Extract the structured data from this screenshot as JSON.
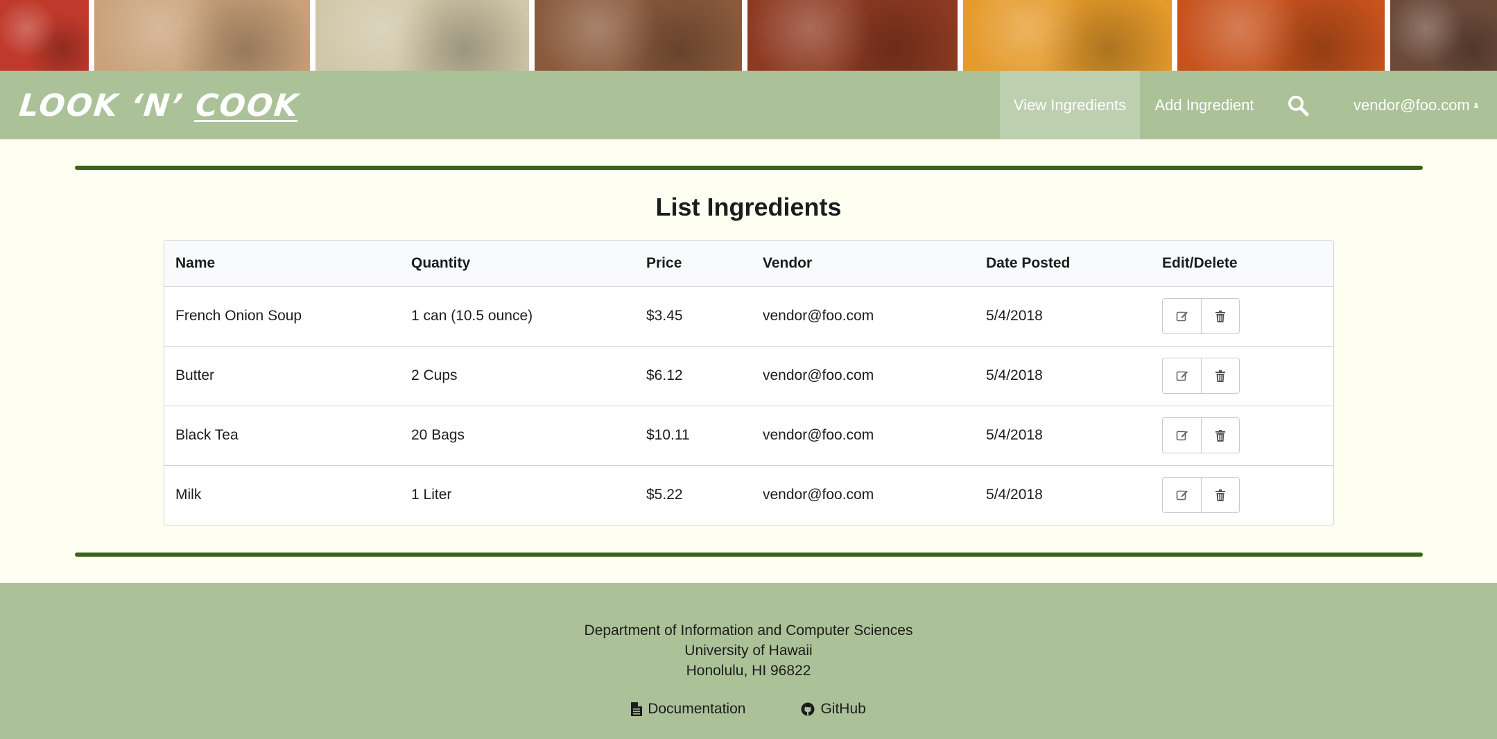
{
  "banner": {
    "tiles": [
      {
        "name": "strawberry-photo",
        "color": "#c0392b"
      },
      {
        "name": "bread-photo",
        "color": "#c9a27a"
      },
      {
        "name": "salad-photo",
        "color": "#cfc7a8"
      },
      {
        "name": "granola-photo",
        "color": "#8a5a3c"
      },
      {
        "name": "tomato-photo",
        "color": "#8e3a22"
      },
      {
        "name": "mango-photo",
        "color": "#e59a2a"
      },
      {
        "name": "glazed-chicken-photo",
        "color": "#c7521c"
      },
      {
        "name": "chocolate-photo",
        "color": "#6b4a3a"
      }
    ]
  },
  "nav": {
    "logo_part1": "LOOK ‘N’",
    "logo_part2": "COOK",
    "view_ingredients": "View Ingredients",
    "add_ingredient": "Add Ingredient",
    "search_icon": "search-icon",
    "user_email": "vendor@foo.com",
    "user_icon": "user-icon",
    "bg_color": "#abc198",
    "active_bg_color": "#bccfae"
  },
  "main": {
    "title": "List Ingredients",
    "rule_color": "#3d6216",
    "columns": [
      "Name",
      "Quantity",
      "Price",
      "Vendor",
      "Date Posted",
      "Edit/Delete"
    ],
    "rows": [
      {
        "name": "French Onion Soup",
        "quantity": "1 can (10.5 ounce)",
        "price": "$3.45",
        "vendor": "vendor@foo.com",
        "date": "5/4/2018"
      },
      {
        "name": "Butter",
        "quantity": "2 Cups",
        "price": "$6.12",
        "vendor": "vendor@foo.com",
        "date": "5/4/2018"
      },
      {
        "name": "Black Tea",
        "quantity": "20 Bags",
        "price": "$10.11",
        "vendor": "vendor@foo.com",
        "date": "5/4/2018"
      },
      {
        "name": "Milk",
        "quantity": "1 Liter",
        "price": "$5.22",
        "vendor": "vendor@foo.com",
        "date": "5/4/2018"
      }
    ],
    "edit_icon": "edit-icon",
    "delete_icon": "trash-icon"
  },
  "footer": {
    "line1": "Department of Information and Computer Sciences",
    "line2": "University of Hawaii",
    "line3": "Honolulu, HI 96822",
    "documentation": "Documentation",
    "github": "GitHub",
    "documentation_icon": "file-icon",
    "github_icon": "github-icon"
  }
}
